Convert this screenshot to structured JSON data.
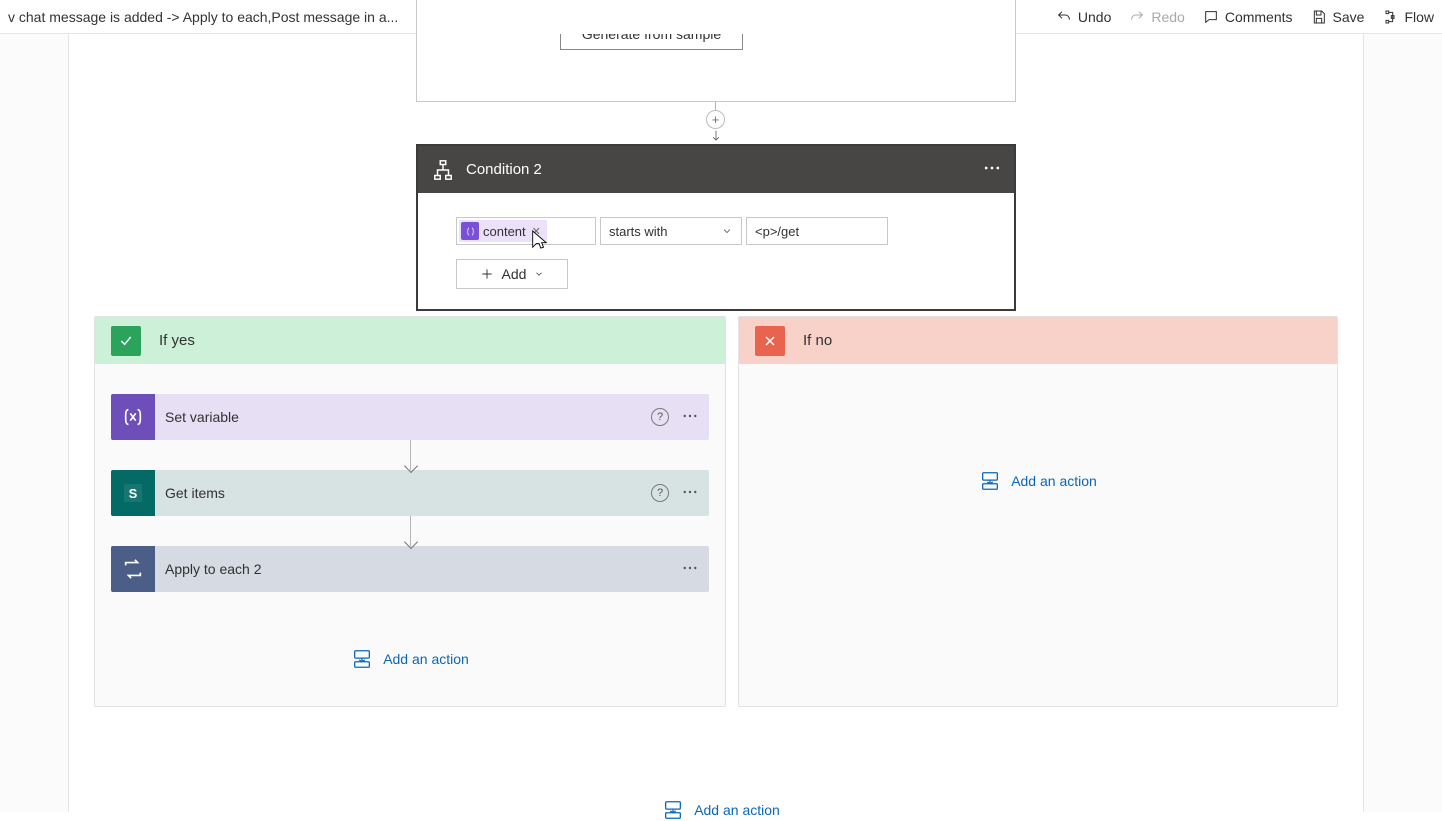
{
  "topbar": {
    "breadcrumb": "v chat message is added -> Apply to each,Post message in a...",
    "undo": "Undo",
    "redo": "Redo",
    "comments": "Comments",
    "save": "Save",
    "flow": "Flow"
  },
  "upper_card": {
    "button_label": "Generate from sample"
  },
  "plus_label": "+",
  "condition": {
    "title": "Condition 2",
    "token_label": "content",
    "operator": "starts with",
    "value": "<p>/get",
    "add_label": "Add"
  },
  "branches": {
    "yes_label": "If yes",
    "no_label": "If no",
    "actions": {
      "setvar": "Set variable",
      "getitems": "Get items",
      "applyeach": "Apply to each 2"
    },
    "add_action": "Add an action"
  }
}
